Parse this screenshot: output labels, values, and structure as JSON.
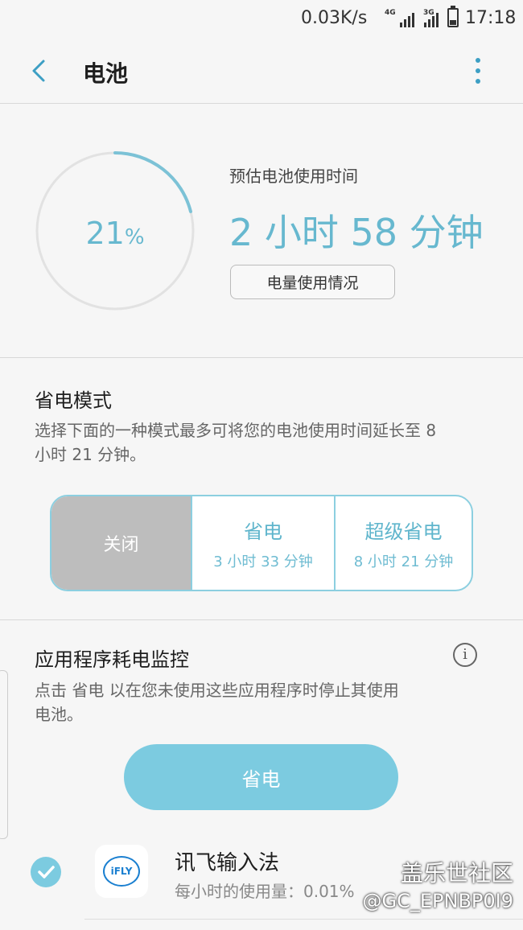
{
  "status_bar": {
    "network_speed": "0.03K/s",
    "net_type_1": "4G",
    "net_type_2": "3G",
    "time": "17:18"
  },
  "header": {
    "title": "电池",
    "back_icon": "chevron-left-icon",
    "more_icon": "more-vertical-icon"
  },
  "battery": {
    "percent_number": "21",
    "percent_sign": "%",
    "level_fraction": 0.21,
    "estimate_label": "预估电池使用时间",
    "estimate_value": "2 小时 58 分钟",
    "usage_button": "电量使用情况"
  },
  "power_mode": {
    "title": "省电模式",
    "description": "选择下面的一种模式最多可将您的电池使用时间延长至 8 小时 21 分钟。",
    "options": [
      {
        "name": "关闭",
        "selected": true
      },
      {
        "name": "省电",
        "time": "3 小时 33 分钟"
      },
      {
        "name": "超级省电",
        "time": "8 小时 21 分钟"
      }
    ]
  },
  "app_monitor": {
    "title": "应用程序耗电监控",
    "info_icon": "info-icon",
    "description": "点击 省电 以在您未使用这些应用程序时停止其使用电池。",
    "save_button": "省电",
    "apps": [
      {
        "name": "讯飞输入法",
        "icon_text": "iFLY",
        "usage": "每小时的使用量：0.01%",
        "checked": true
      }
    ]
  },
  "watermark": {
    "line1": "盖乐世社区",
    "line2": "@GC_EPNBP0I9"
  },
  "colors": {
    "accent": "#67b8cf",
    "accent_button": "#7ccbe0",
    "selected_mode_bg": "#bdbdbd"
  }
}
